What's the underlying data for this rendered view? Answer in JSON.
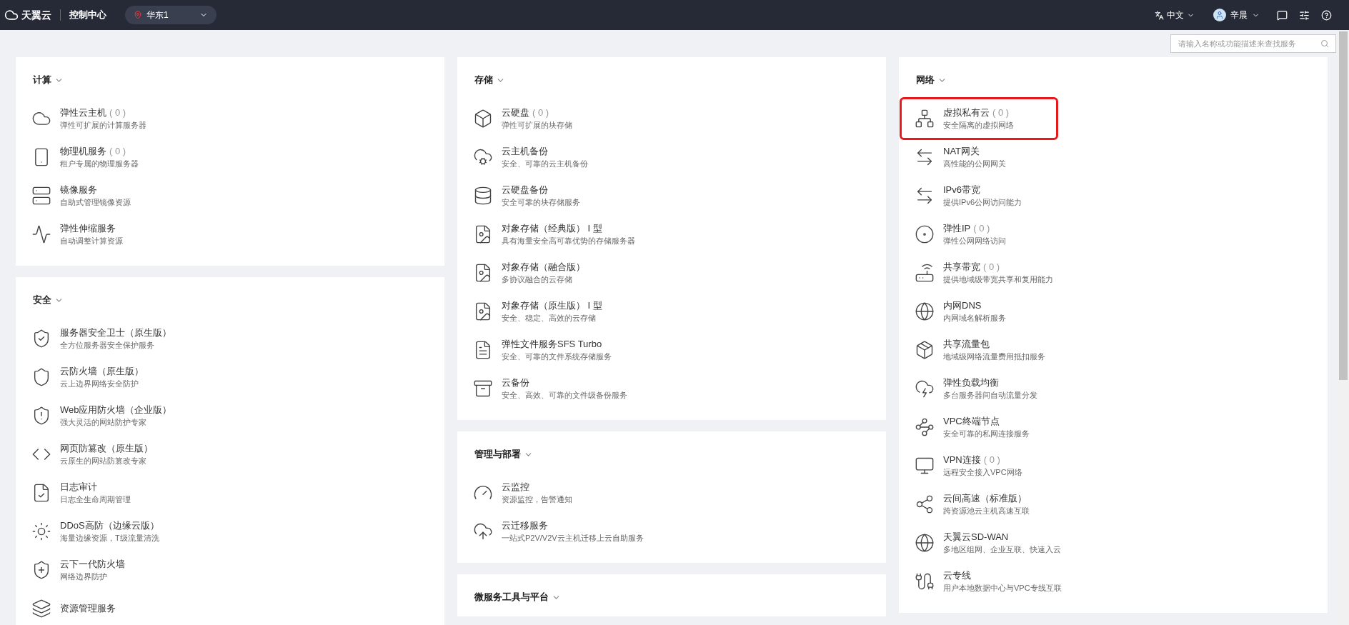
{
  "topbar": {
    "brand": "天翼云",
    "console": "控制中心",
    "region": "华东1",
    "language": "中文",
    "user": "辛晨"
  },
  "search": {
    "placeholder": "请输入名称或功能描述来查找服务"
  },
  "columns": [
    {
      "sections": [
        {
          "title": "计算",
          "items": [
            {
              "title": "弹性云主机",
              "count": "( 0 )",
              "desc": "弹性可扩展的计算服务器"
            },
            {
              "title": "物理机服务",
              "count": "( 0 )",
              "desc": "租户专属的物理服务器"
            },
            {
              "title": "镜像服务",
              "desc": "自助式管理镜像资源"
            },
            {
              "title": "弹性伸缩服务",
              "desc": "自动调整计算资源"
            }
          ]
        },
        {
          "title": "安全",
          "items": [
            {
              "title": "服务器安全卫士（原生版）",
              "desc": "全方位服务器安全保护服务"
            },
            {
              "title": "云防火墙（原生版）",
              "desc": "云上边界网络安全防护"
            },
            {
              "title": "Web应用防火墙（企业版）",
              "desc": "强大灵活的网站防护专家"
            },
            {
              "title": "网页防篡改（原生版）",
              "desc": "云原生的网站防篡改专家"
            },
            {
              "title": "日志审计",
              "desc": "日志全生命周期管理"
            },
            {
              "title": "DDoS高防（边缘云版）",
              "desc": "海量边缘资源，T级流量清洗"
            },
            {
              "title": "云下一代防火墙",
              "desc": "网络边界防护"
            },
            {
              "title": "资源管理服务"
            }
          ]
        }
      ]
    },
    {
      "sections": [
        {
          "title": "存储",
          "items": [
            {
              "title": "云硬盘",
              "count": "( 0 )",
              "desc": "弹性可扩展的块存储"
            },
            {
              "title": "云主机备份",
              "desc": "安全、可靠的云主机备份"
            },
            {
              "title": "云硬盘备份",
              "desc": "安全可靠的块存储服务"
            },
            {
              "title": "对象存储（经典版） I 型",
              "desc": "具有海量安全高可靠优势的存储服务器"
            },
            {
              "title": "对象存储（融合版）",
              "desc": "多协议融合的云存储"
            },
            {
              "title": "对象存储（原生版） I 型",
              "desc": "安全、稳定、高效的云存储"
            },
            {
              "title": "弹性文件服务SFS Turbo",
              "desc": "安全、可靠的文件系统存储服务"
            },
            {
              "title": "云备份",
              "desc": "安全、高效、可靠的文件级备份服务"
            }
          ]
        },
        {
          "title": "管理与部署",
          "items": [
            {
              "title": "云监控",
              "desc": "资源监控，告警通知"
            },
            {
              "title": "云迁移服务",
              "desc": "一站式P2V/V2V云主机迁移上云自助服务"
            }
          ]
        },
        {
          "title": "微服务工具与平台"
        }
      ]
    },
    {
      "sections": [
        {
          "title": "网络",
          "items": [
            {
              "title": "虚拟私有云",
              "count": "( 0 )",
              "desc": "安全隔离的虚拟网络",
              "highlighted": true
            },
            {
              "title": "NAT网关",
              "desc": "高性能的公网网关",
              "highlighted": false
            },
            {
              "title": "IPv6带宽",
              "desc": "提供IPv6公网访问能力",
              "highlighted": false
            },
            {
              "title": "弹性IP",
              "count": "( 0 )",
              "desc": "弹性公网网络访问",
              "highlighted": false
            },
            {
              "title": "共享带宽",
              "count": "( 0 )",
              "desc": "提供地域级带宽共享和复用能力",
              "highlighted": false
            },
            {
              "title": "内网DNS",
              "desc": "内网域名解析服务",
              "highlighted": false
            },
            {
              "title": "共享流量包",
              "desc": "地域级网络流量费用抵扣服务",
              "highlighted": false
            },
            {
              "title": "弹性负载均衡",
              "desc": "多台服务器间自动流量分发",
              "highlighted": false
            },
            {
              "title": "VPC终端节点",
              "desc": "安全可靠的私网连接服务",
              "highlighted": false
            },
            {
              "title": "VPN连接",
              "count": "( 0 )",
              "desc": "远程安全接入VPC网络",
              "highlighted": false
            },
            {
              "title": "云间高速（标准版）",
              "desc": "跨资源池云主机高速互联",
              "highlighted": false
            },
            {
              "title": "天翼云SD-WAN",
              "desc": "多地区组网、企业互联、快速入云",
              "highlighted": false
            },
            {
              "title": "云专线",
              "desc": "用户本地数据中心与VPC专线互联",
              "highlighted": false
            }
          ]
        }
      ]
    }
  ]
}
